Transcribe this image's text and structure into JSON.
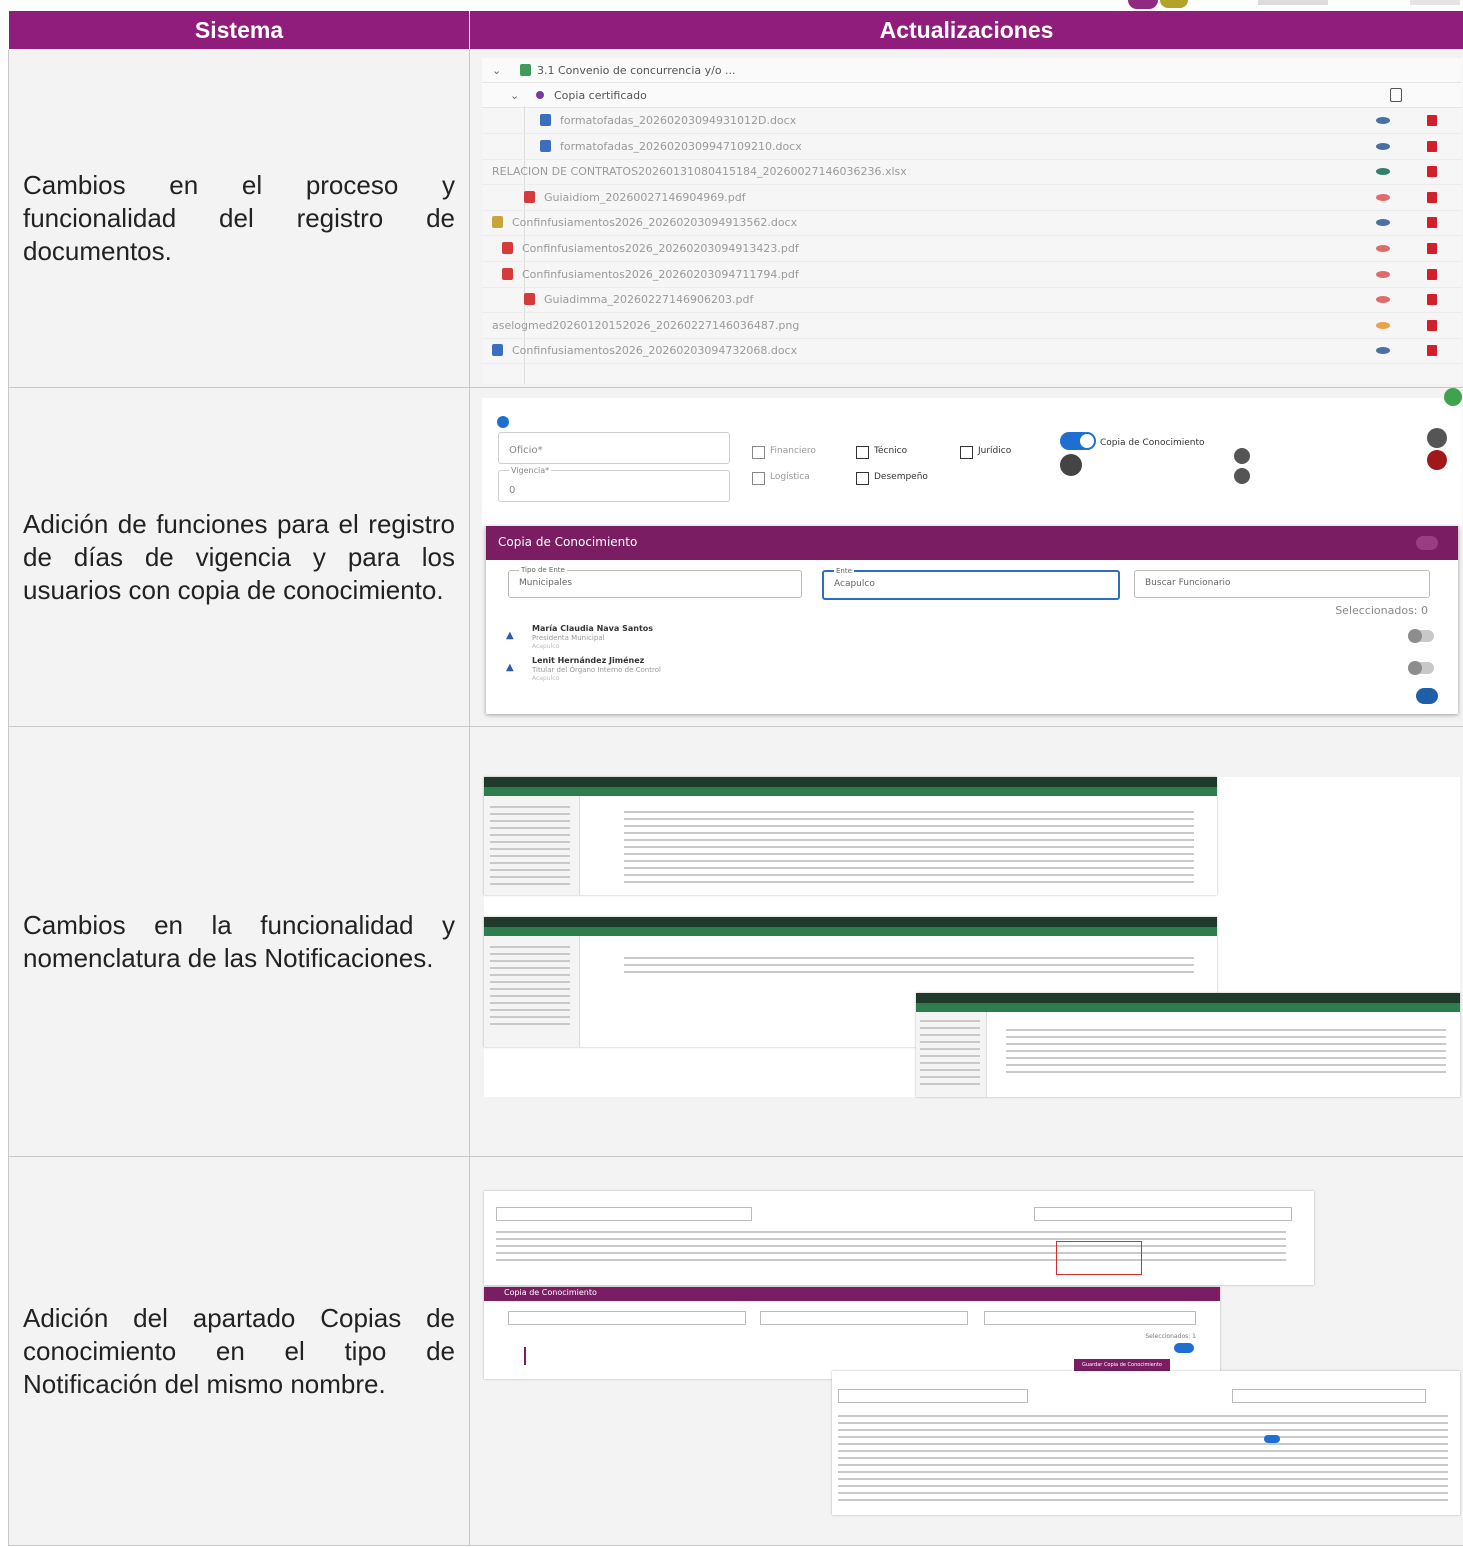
{
  "table": {
    "headers": {
      "sistema": "Sistema",
      "actualizaciones": "Actualizaciones"
    },
    "rows": [
      {
        "sistema": "Cambios en el proceso y funcionalidad del registro de documentos."
      },
      {
        "sistema": "Adición de funciones para el registro de días de vigencia y para los usuarios con copia de conocimiento."
      },
      {
        "sistema": "Cambios en la funcionalidad y nomenclatura de las Notificaciones."
      },
      {
        "sistema": "Adición del apartado Copias de conocimiento en el tipo de Notificación del mismo nombre."
      }
    ]
  },
  "shot1": {
    "folder": "3.1 Convenio de concurrencia y/o ...",
    "subfolder": "Copia certificado",
    "files": [
      "formatofadas_20260203094931012D.docx",
      "formatofadas_2026020309947109210.docx",
      "RELACION DE CONTRATOS20260131080415184_20260027146036236.xlsx",
      "Guiaidiom_20260027146904969.pdf",
      "Confinfusiamentos2026_20260203094913562.docx",
      "Confinfusiamentos2026_20260203094913423.pdf",
      "Confinfusiamentos2026_20260203094711794.pdf",
      "Guiadimma_20260227146906203.pdf",
      "aselogmed20260120152026_20260227146036487.png",
      "Confinfusiamentos2026_20260203094732068.docx"
    ],
    "eye_colors": [
      "#4a6fa5",
      "#4a6fa5",
      "#2f7f6a",
      "#e06b6b",
      "#4a6fa5",
      "#e06b6b",
      "#e06b6b",
      "#e06b6b",
      "#e8a24a",
      "#4a6fa5"
    ]
  },
  "shot2": {
    "oficio": "Oficio*",
    "vigencia_label": "Vigencia*",
    "vigencia_value": "0",
    "checks": [
      "Financiero",
      "Técnico",
      "Jurídico",
      "Logística",
      "Desempeño"
    ],
    "copia_label": "Copia de Conocimiento",
    "modal_title": "Copia de Conocimiento",
    "tipo_label": "Tipo de Ente",
    "tipo_value": "Municipales",
    "ente_label": "Ente",
    "ente_value": "Acapulco",
    "search_placeholder": "Buscar Funcionario",
    "selected": "Seleccionados: 0",
    "users": [
      {
        "name": "María Claudia Nava Santos",
        "role": "Presidenta Municipal",
        "ente": "Acapulco"
      },
      {
        "name": "Lenit Hernández Jiménez",
        "role": "Titular del Órgano Interno de Control",
        "ente": "Acapulco"
      }
    ]
  },
  "shot4": {
    "modal_title": "Copia de Conocimiento",
    "seleccionados": "Seleccionados: 1",
    "button": "Guardar Copia de Conocimiento"
  }
}
